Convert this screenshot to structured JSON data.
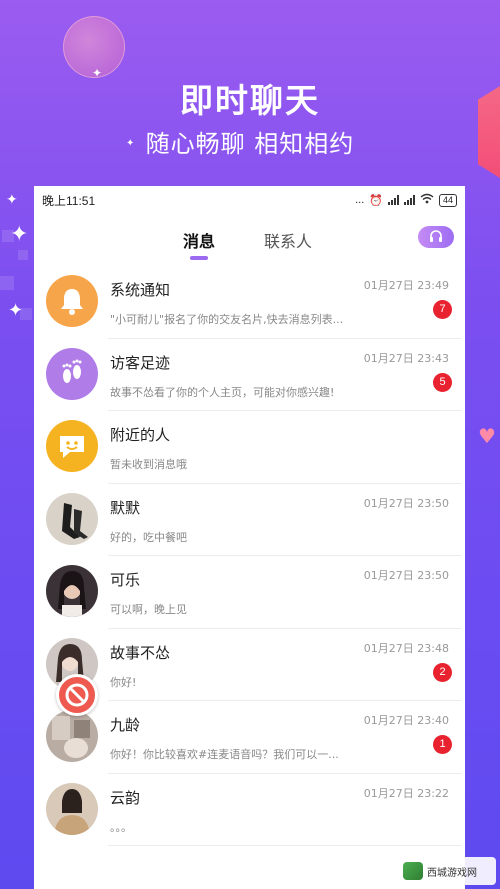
{
  "hero": {
    "title": "即时聊天",
    "subtitle": "随心畅聊 相知相约"
  },
  "status_bar": {
    "time": "晚上11:51",
    "indicators": "...",
    "battery": "44"
  },
  "tabs": [
    {
      "label": "消息",
      "active": true
    },
    {
      "label": "联系人",
      "active": false
    }
  ],
  "customer_service_icon": "headset-icon",
  "conversations": [
    {
      "name": "系统通知",
      "preview": "\"小可耐儿\"报名了你的交友名片,快去消息列表...",
      "time": "01月27日 23:49",
      "badge": "7",
      "avatar": "bell-icon",
      "avatar_color": "#f7a54b"
    },
    {
      "name": "访客足迹",
      "preview": "故事不怂看了你的个人主页，可能对你感兴趣!",
      "time": "01月27日 23:43",
      "badge": "5",
      "avatar": "footprints-icon",
      "avatar_color": "#b07ce8"
    },
    {
      "name": "附近的人",
      "preview": "暂未收到消息哦",
      "time": "",
      "badge": "",
      "avatar": "chat-bubble-icon",
      "avatar_color": "#f5b321"
    },
    {
      "name": "默默",
      "preview": "好的，吃中餐吧",
      "time": "01月27日 23:50",
      "badge": "",
      "avatar": "user-photo-boots",
      "avatar_color": "#d9d2c8"
    },
    {
      "name": "可乐",
      "preview": "可以啊，晚上见",
      "time": "01月27日 23:50",
      "badge": "",
      "avatar": "user-photo-woman",
      "avatar_color": "#3a3236"
    },
    {
      "name": "故事不怂",
      "preview": "你好!",
      "time": "01月27日 23:48",
      "badge": "2",
      "avatar": "user-photo-woman-light",
      "avatar_color": "#cfc7c3"
    },
    {
      "name": "九龄",
      "preview": "你好！你比较喜欢#连麦语音吗？我们可以一...",
      "time": "01月27日 23:40",
      "badge": "1",
      "avatar": "user-photo-interior",
      "avatar_color": "#b9aca3"
    },
    {
      "name": "云韵",
      "preview": "。。。",
      "time": "01月27日 23:22",
      "badge": "",
      "avatar": "user-photo-fur",
      "avatar_color": "#d8c9b8"
    }
  ],
  "overlay": {
    "block_icon": "prohibited-icon",
    "block_color": "#ee5a4f"
  },
  "watermark": {
    "text": "西城游戏网"
  },
  "colors": {
    "background_top": "#9b5cf0",
    "background_bottom": "#5d4aef",
    "accent": "#9b6af0",
    "badge": "#e8232f"
  }
}
